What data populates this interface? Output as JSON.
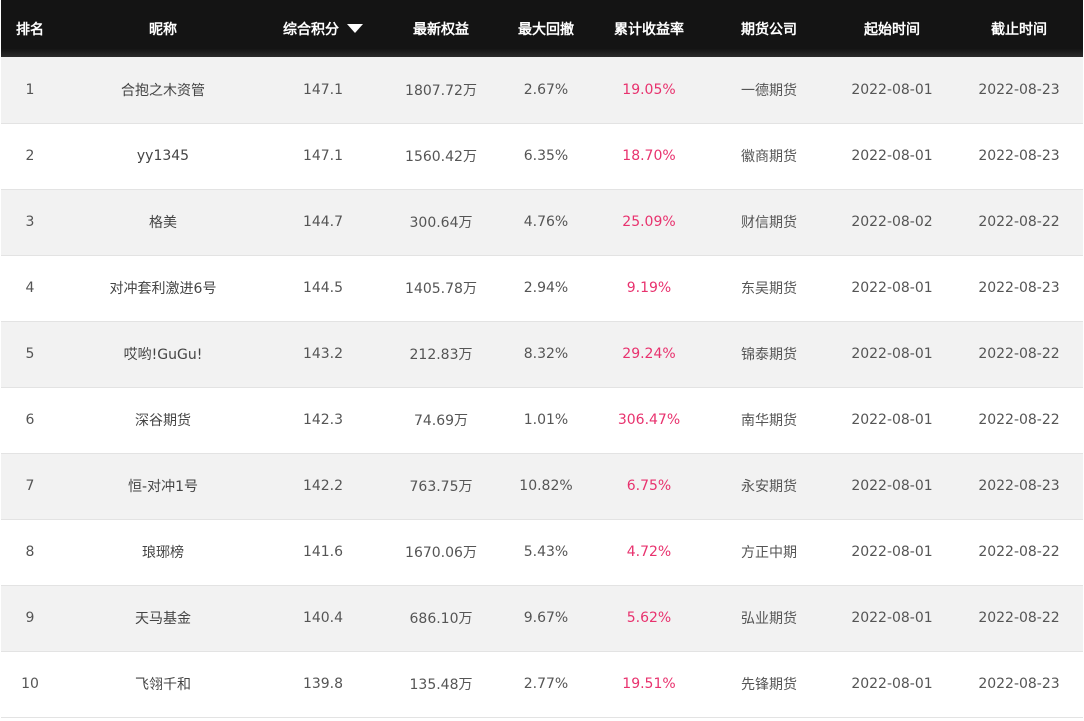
{
  "header": {
    "rank": "排名",
    "nickname": "昵称",
    "score": "综合积分",
    "equity": "最新权益",
    "drawdown": "最大回撤",
    "return": "累计收益率",
    "company": "期货公司",
    "start": "起始时间",
    "end": "截止时间",
    "sort_icon": "caret-down-icon"
  },
  "colors": {
    "header_bg": "#141414",
    "row_odd": "#f2f2f2",
    "row_even": "#ffffff",
    "return_text": "#e8326e",
    "body_text": "#555555"
  },
  "rows": [
    {
      "rank": "1",
      "name": "合抱之木资管",
      "score": "147.1",
      "equity": "1807.72万",
      "drawdown": "2.67%",
      "return": "19.05%",
      "company": "一德期货",
      "start": "2022-08-01",
      "end": "2022-08-23"
    },
    {
      "rank": "2",
      "name": "yy1345",
      "score": "147.1",
      "equity": "1560.42万",
      "drawdown": "6.35%",
      "return": "18.70%",
      "company": "徽商期货",
      "start": "2022-08-01",
      "end": "2022-08-23"
    },
    {
      "rank": "3",
      "name": "格美",
      "score": "144.7",
      "equity": "300.64万",
      "drawdown": "4.76%",
      "return": "25.09%",
      "company": "财信期货",
      "start": "2022-08-02",
      "end": "2022-08-22"
    },
    {
      "rank": "4",
      "name": "对冲套利激进6号",
      "score": "144.5",
      "equity": "1405.78万",
      "drawdown": "2.94%",
      "return": "9.19%",
      "company": "东吴期货",
      "start": "2022-08-01",
      "end": "2022-08-23"
    },
    {
      "rank": "5",
      "name": "哎哟!GuGu!",
      "score": "143.2",
      "equity": "212.83万",
      "drawdown": "8.32%",
      "return": "29.24%",
      "company": "锦泰期货",
      "start": "2022-08-01",
      "end": "2022-08-22"
    },
    {
      "rank": "6",
      "name": "深谷期货",
      "score": "142.3",
      "equity": "74.69万",
      "drawdown": "1.01%",
      "return": "306.47%",
      "company": "南华期货",
      "start": "2022-08-01",
      "end": "2022-08-22"
    },
    {
      "rank": "7",
      "name": "恒-对冲1号",
      "score": "142.2",
      "equity": "763.75万",
      "drawdown": "10.82%",
      "return": "6.75%",
      "company": "永安期货",
      "start": "2022-08-01",
      "end": "2022-08-23"
    },
    {
      "rank": "8",
      "name": "琅琊榜",
      "score": "141.6",
      "equity": "1670.06万",
      "drawdown": "5.43%",
      "return": "4.72%",
      "company": "方正中期",
      "start": "2022-08-01",
      "end": "2022-08-22"
    },
    {
      "rank": "9",
      "name": "天马基金",
      "score": "140.4",
      "equity": "686.10万",
      "drawdown": "9.67%",
      "return": "5.62%",
      "company": "弘业期货",
      "start": "2022-08-01",
      "end": "2022-08-22"
    },
    {
      "rank": "10",
      "name": "飞翎千和",
      "score": "139.8",
      "equity": "135.48万",
      "drawdown": "2.77%",
      "return": "19.51%",
      "company": "先锋期货",
      "start": "2022-08-01",
      "end": "2022-08-23"
    }
  ]
}
